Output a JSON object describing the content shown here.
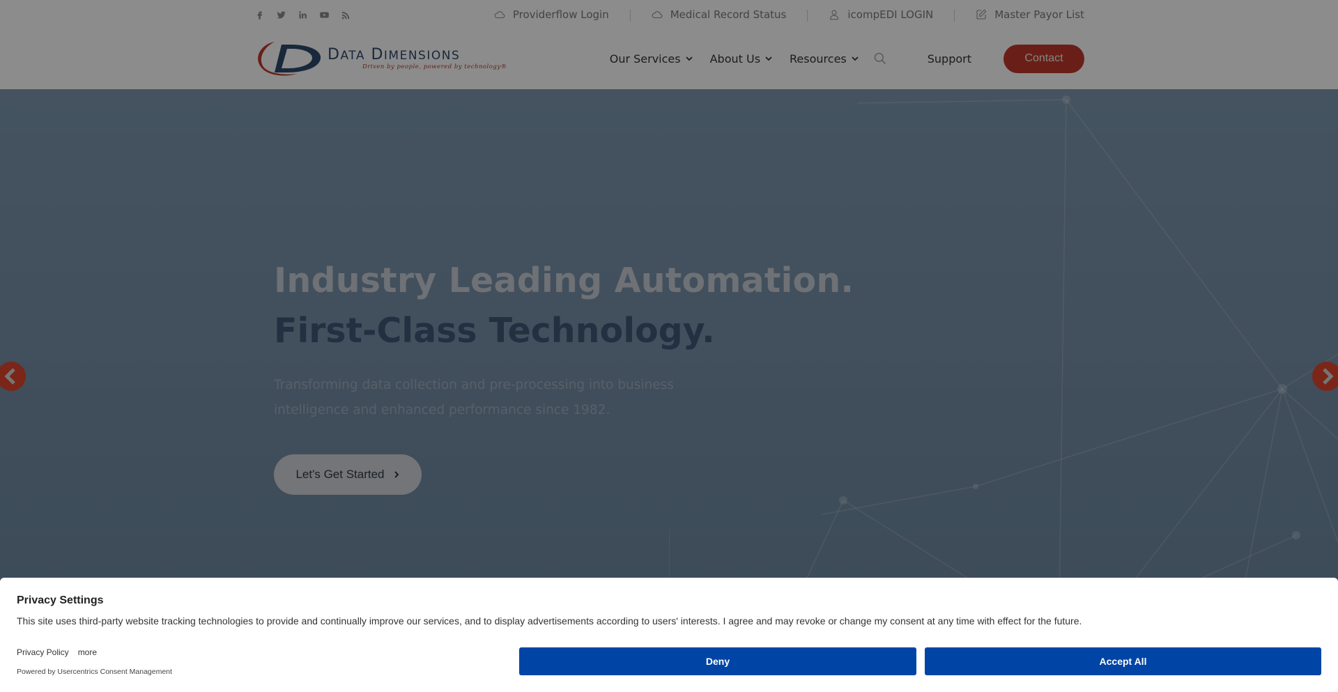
{
  "header": {
    "socials": [
      {
        "icon": "facebook-icon",
        "glyph": "f"
      },
      {
        "icon": "twitter-icon",
        "glyph": ""
      },
      {
        "icon": "linkedin-icon",
        "glyph": "in"
      },
      {
        "icon": "youtube-icon",
        "glyph": ""
      },
      {
        "icon": "rss-icon",
        "glyph": ""
      }
    ],
    "top_links": [
      {
        "label": "Providerflow Login",
        "icon": "cloud-icon"
      },
      {
        "label": "Medical Record Status",
        "icon": "cloud-icon"
      },
      {
        "label": "icompEDI LOGIN",
        "icon": "user-icon"
      },
      {
        "label": "Master Payor List",
        "icon": "edit-icon"
      }
    ],
    "logo": {
      "title_first": "D",
      "title_first_rest": "ATA",
      "title_second": "D",
      "title_second_rest": "IMENSIONS",
      "tagline": "Driven by people, powered by technology®"
    },
    "nav": [
      {
        "label": "Our Services",
        "has_dropdown": true
      },
      {
        "label": "About Us",
        "has_dropdown": true
      },
      {
        "label": "Resources",
        "has_dropdown": true
      }
    ],
    "support_label": "Support",
    "contact_label": "Contact"
  },
  "hero": {
    "line1": "Industry Leading Automation.",
    "line2": "First-Class Technology.",
    "subtitle": "Transforming data collection and pre-processing into business intelligence and enhanced performance since 1982.",
    "cta_label": "Let's Get Started",
    "prev_label": "previous slide",
    "next_label": "next slide"
  },
  "consent": {
    "title": "Privacy Settings",
    "text": "This site uses third-party website tracking technologies to provide and continually improve our services, and to display advertisements according to users' interests. I agree and may revoke or change my consent at any time with effect for the future.",
    "privacy_policy_label": "Privacy Policy",
    "more_label": "more",
    "powered_by": "Powered by Usercentrics Consent Management",
    "deny_label": "Deny",
    "accept_label": "Accept All"
  },
  "colors": {
    "brand_red": "#c0392b",
    "brand_blue": "#2e4a6a",
    "consent_button": "#0045a5"
  }
}
